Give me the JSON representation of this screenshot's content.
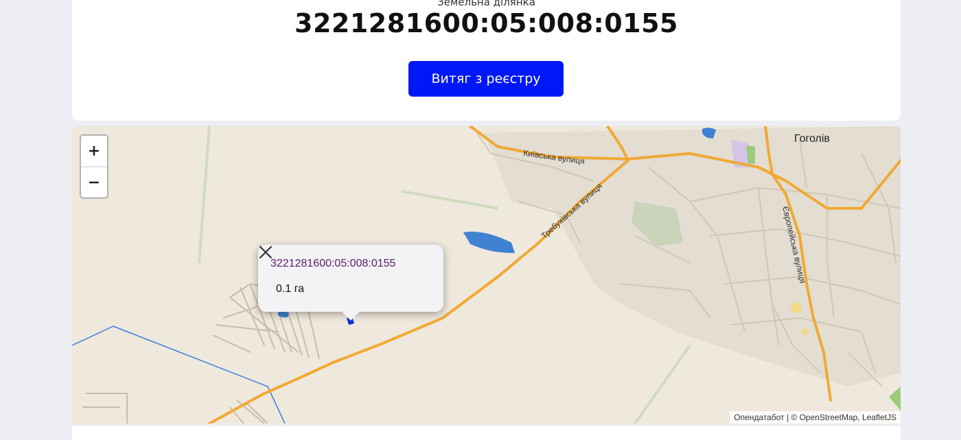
{
  "header": {
    "subtitle": "Земельна ділянка",
    "cadastral_number": "3221281600:05:008:0155",
    "extract_button_label": "Витяг з реєстру"
  },
  "map": {
    "zoom_in_label": "+",
    "zoom_out_label": "−",
    "town_label": "Гоголів",
    "streets": {
      "kyivska": "Київська вулиця",
      "trebukhivska": "Требухівська вулиця",
      "yevropeiska": "Європейська вулиця"
    },
    "popup": {
      "title": "3221281600:05:008:0155",
      "area": "0.1 га"
    },
    "attribution": "Опендатабот | © OpenStreetMap, LeafletJS",
    "colors": {
      "land": "#efe8dc",
      "major_road": "#f1a932",
      "minor_road": "#d9cfbf",
      "water": "#3f82d1",
      "parcel": "#0a32d6",
      "boundary": "#3b7fe0"
    }
  }
}
